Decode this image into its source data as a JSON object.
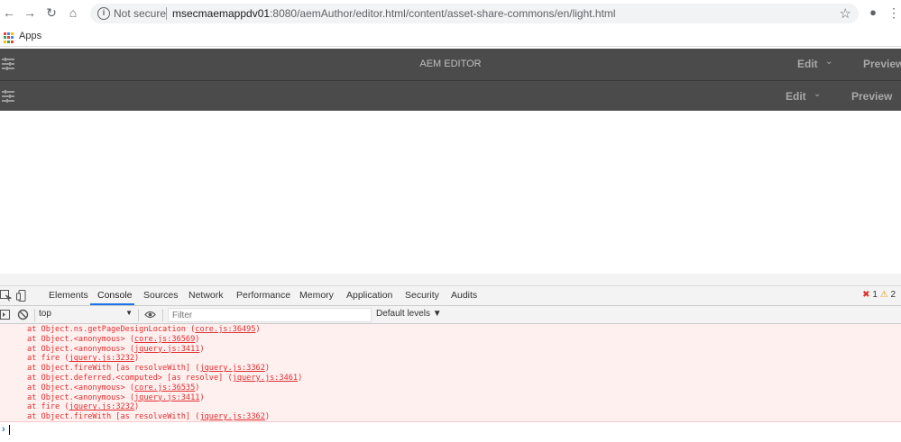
{
  "browser": {
    "not_secure": "Not secure",
    "url_host": "msecmaemappdv01",
    "url_rest": ":8080/aemAuthor/editor.html/content/asset-share-commons/en/light.html",
    "bookmarks": {
      "apps_label": "Apps"
    }
  },
  "aem_top": {
    "title": "AEM EDITOR",
    "edit_label": "Edit",
    "preview_label": "Preview"
  },
  "aem_second": {
    "edit_label": "Edit",
    "preview_label": "Preview"
  },
  "devtools": {
    "tabs": [
      "Elements",
      "Console",
      "Sources",
      "Network",
      "Performance",
      "Memory",
      "Application",
      "Security",
      "Audits"
    ],
    "active_tab": "Console",
    "error_count": "1",
    "warning_count": "2",
    "context": "top",
    "filter_placeholder": "Filter",
    "levels": "Default levels ▼",
    "console_lines": [
      {
        "text": "at Object.ns.getPageDesignLocation (",
        "src": "core.js:36495",
        "tail": ")"
      },
      {
        "text": "at Object.<anonymous> (",
        "src": "core.js:36569",
        "tail": ")"
      },
      {
        "text": "at Object.<anonymous> (",
        "src": "jquery.js:3411",
        "tail": ")"
      },
      {
        "text": "at fire (",
        "src": "jquery.js:3232",
        "tail": ")"
      },
      {
        "text": "at Object.fireWith [as resolveWith] (",
        "src": "jquery.js:3362",
        "tail": ")"
      },
      {
        "text": "at Object.deferred.<computed> [as resolve] (",
        "src": "jquery.js:3461",
        "tail": ")"
      },
      {
        "text": "at Object.<anonymous> (",
        "src": "core.js:36535",
        "tail": ")"
      },
      {
        "text": "at Object.<anonymous> (",
        "src": "jquery.js:3411",
        "tail": ")"
      },
      {
        "text": "at fire (",
        "src": "jquery.js:3232",
        "tail": ")"
      },
      {
        "text": "at Object.fireWith [as resolveWith] (",
        "src": "jquery.js:3362",
        "tail": ")"
      }
    ]
  },
  "colors": {
    "aem_bar": "#4b4b4b",
    "error_red": "#e02e2e",
    "accent_blue": "#1a73e8"
  }
}
